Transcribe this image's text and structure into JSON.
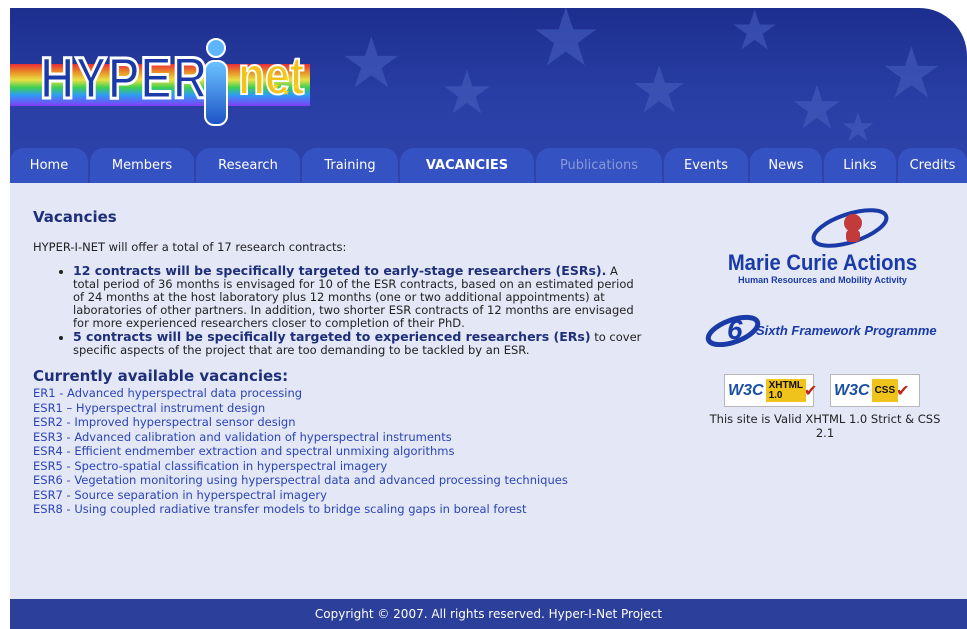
{
  "header": {
    "logo_left": "HYPER",
    "logo_right": "net"
  },
  "nav": {
    "tabs": [
      {
        "label": "Home"
      },
      {
        "label": "Members"
      },
      {
        "label": "Research"
      },
      {
        "label": "Training"
      },
      {
        "label": "VACANCIES",
        "active": true
      },
      {
        "label": "Publications",
        "disabled": true
      },
      {
        "label": "Events"
      },
      {
        "label": "News"
      },
      {
        "label": "Links"
      },
      {
        "label": "Credits"
      }
    ]
  },
  "main": {
    "title": "Vacancies",
    "intro": "HYPER-I-NET will offer a total of 17 research contracts:",
    "bullets": [
      {
        "strong": "12 contracts will be specifically targeted to early-stage researchers (ESRs).",
        "text": " A total period of 36 months is envisaged for 10 of the ESR contracts, based on an estimated period of 24 months at the host laboratory plus 12 months (one or two additional appointments) at laboratories of other partners. In addition, two shorter ESR contracts of 12 months are envisaged for more experienced researchers closer to completion of their PhD."
      },
      {
        "strong": "5 contracts will be specifically targeted to experienced researchers (ERs)",
        "text": " to cover specific aspects of the project that are too demanding to be tackled by an ESR."
      }
    ],
    "vacancies_title": "Currently available vacancies:",
    "vacancies": [
      "ER1 - Advanced hyperspectral data processing",
      "ESR1 – Hyperspectral instrument design",
      "ESR2 - Improved hyperspectral sensor design",
      "ESR3 - Advanced calibration and validation of hyperspectral instruments",
      "ESR4 - Efficient endmember extraction and spectral unmixing algorithms",
      "ESR5 - Spectro-spatial classification in hyperspectral imagery",
      "ESR6 - Vegetation monitoring using hyperspectral data and advanced processing techniques",
      "ESR7 - Source separation in hyperspectral imagery",
      "ESR8 - Using coupled radiative transfer models to bridge scaling gaps in boreal forest"
    ]
  },
  "sidebar": {
    "mca_title": "Marie Curie Actions",
    "mca_subtitle": "Human Resources and Mobility Activity",
    "fp6_number": "6",
    "fp6_text": "Sixth Framework Programme",
    "badges": [
      {
        "w3c": "W3C",
        "line1": "XHTML",
        "line2": "1.0"
      },
      {
        "w3c": "W3C",
        "line1": "CSS",
        "line2": ""
      }
    ],
    "validity_note": "This site is Valid XHTML 1.0 Strict & CSS 2.1"
  },
  "footer": {
    "copyright": "Copyright © 2007. All rights reserved. Hyper-I-Net Project"
  },
  "colors": {
    "header_blue": "#1c2f8f",
    "tab_blue": "#3552c3",
    "content_bg": "#e3e7f6",
    "link_blue": "#2b45b5",
    "heading_navy": "#1e2f7a",
    "footer_blue": "#2b3f9b"
  }
}
